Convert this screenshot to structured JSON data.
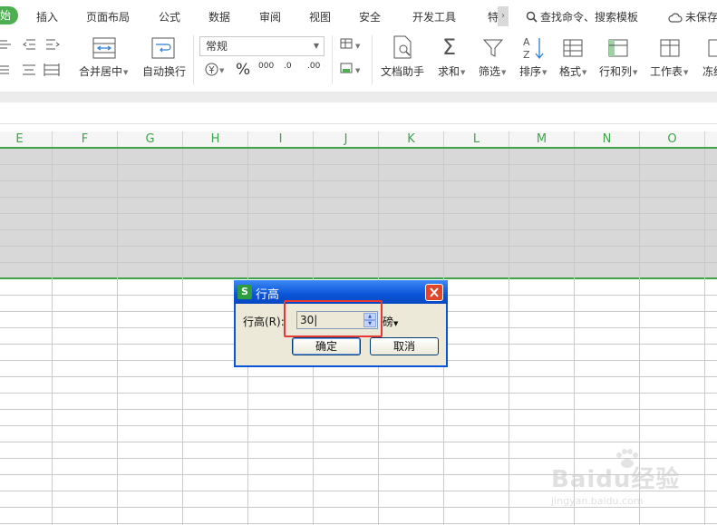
{
  "menu": {
    "start_tab": "始",
    "tabs": [
      "插入",
      "页面布局",
      "公式",
      "数据",
      "审阅",
      "视图",
      "安全",
      "开发工具",
      "特"
    ],
    "search_text": "查找命令、搜索模板",
    "unsaved_text": "未保存"
  },
  "ribbon": {
    "merge_label": "合并居中",
    "wrap_label": "自动换行",
    "number_format": "常规",
    "percent": "%",
    "thousands": "000",
    "dec_inc": ".0",
    "dec_dec": ".00",
    "doc_helper": "文档助手",
    "sum": "求和",
    "filter": "筛选",
    "sort": "排序",
    "format": "格式",
    "row_col": "行和列",
    "worksheet": "工作表",
    "freeze": "冻结"
  },
  "sheet": {
    "columns": [
      "E",
      "F",
      "G",
      "H",
      "I",
      "J",
      "K",
      "L",
      "M",
      "N",
      "O"
    ]
  },
  "dialog": {
    "app_icon": "S",
    "title": "行高",
    "field_label": "行高(R):",
    "value": "30",
    "unit": "磅",
    "ok_label": "确定",
    "cancel_label": "取消"
  },
  "watermark": {
    "brand": "Baidu经验",
    "url": "jingyan.baidu.com"
  },
  "colors": {
    "accent_green": "#3fa34a",
    "dialog_blue": "#0a54d8",
    "highlight_red": "#e53935",
    "selection_gray": "#d8d8d8"
  }
}
